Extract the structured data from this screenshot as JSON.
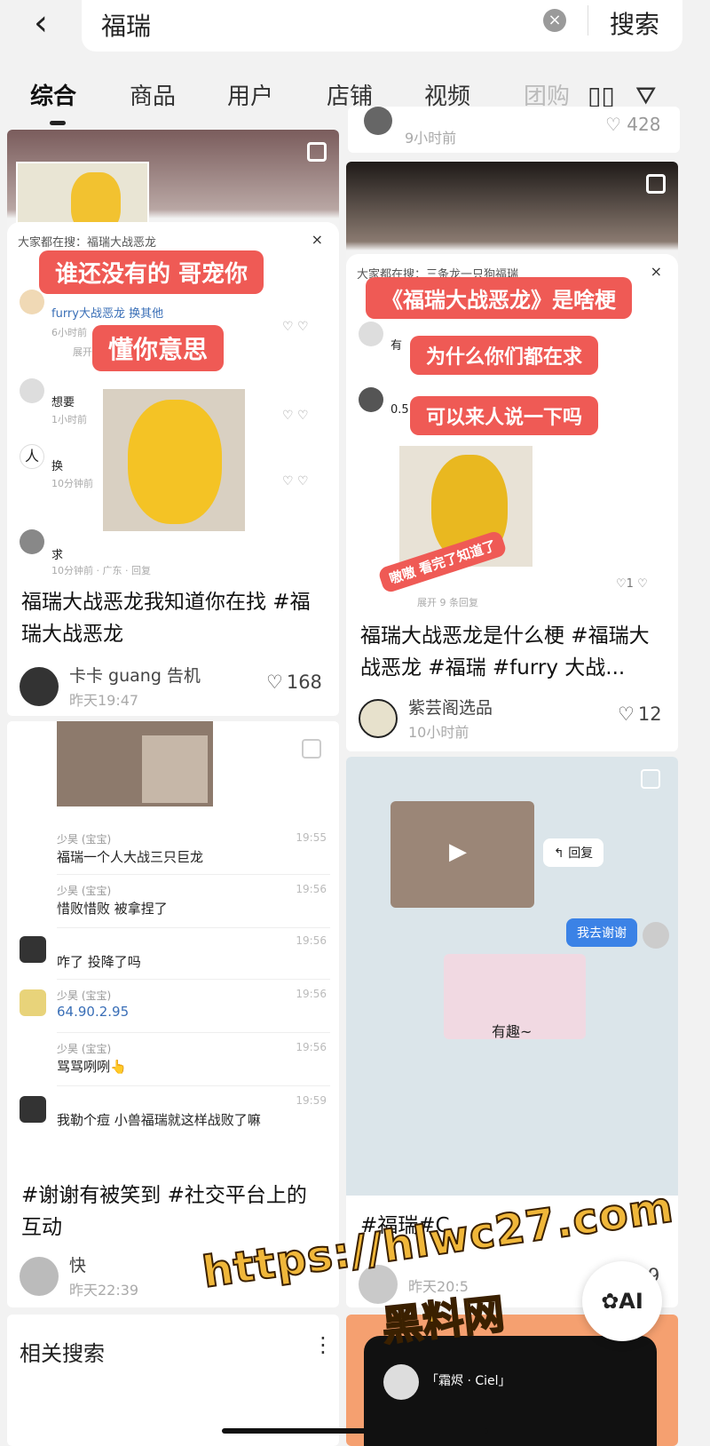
{
  "search": {
    "query": "福瑞",
    "button": "搜索"
  },
  "tabs": [
    "综合",
    "商品",
    "用户",
    "店铺",
    "视频",
    "团购"
  ],
  "top_partial_right": {
    "time": "9小时前",
    "likes": "428"
  },
  "cards": [
    {
      "bubbles": [
        "谁还没有的 哥宠你",
        "懂你意思"
      ],
      "overlay_top": "大家都在搜：福瑞大战恶龙",
      "comments": [
        {
          "text": "furry大战恶龙 换其他",
          "meta": "6小时前"
        },
        {
          "text": "想要",
          "meta": "1小时前"
        },
        {
          "text": "换",
          "meta": "10分钟前"
        },
        {
          "text": "求",
          "meta": "10分钟前 · 广东 · 回复"
        }
      ],
      "expand": "展开",
      "title": "福瑞大战恶龙我知道你在找 #福瑞大战恶龙",
      "author": "卡卡 guang 告机",
      "time": "昨天19:47",
      "likes": "168"
    },
    {
      "overlay_top": "大家都在搜：三条龙一只狗福瑞",
      "bubbles": [
        "《福瑞大战恶龙》是啥梗",
        "为什么你们都在求",
        "可以来人说一下吗"
      ],
      "comments": [
        {
          "text": "有"
        },
        {
          "text": "0.5"
        }
      ],
      "sticker": "嗷嗷 看完了知道了",
      "reply_count": "展开 9 条回复",
      "like_small": "1",
      "title": "福瑞大战恶龙是什么梗 #福瑞大战恶龙 #福瑞 #furry 大战...",
      "author": "紫芸阁选品",
      "time": "10小时前",
      "likes": "12"
    },
    {
      "chat": [
        {
          "name": "少昊 (宝宝)",
          "text": "福瑞一个人大战三只巨龙",
          "time": "19:55"
        },
        {
          "name": "少昊 (宝宝)",
          "text": "惜败惜败 被拿捏了",
          "time": "19:56"
        },
        {
          "name": "",
          "text": "咋了 投降了吗",
          "time": "19:56"
        },
        {
          "name": "少昊 (宝宝)",
          "text": "64.90.2.95",
          "time": "19:56"
        },
        {
          "name": "少昊 (宝宝)",
          "text": "骂骂咧咧👆",
          "time": "19:56"
        },
        {
          "name": "",
          "text": "我勒个痘 小兽福瑞就这样战败了嘛",
          "time": "19:59"
        }
      ],
      "title": "#谢谢有被笑到 #社交平台上的互动",
      "author": "快",
      "time": "昨天22:39"
    },
    {
      "reply": "回复",
      "sent": "我去谢谢",
      "caption": "有趣~",
      "title": "#福瑞#C",
      "time": "昨天20:5",
      "likes": "9"
    }
  ],
  "related": {
    "label": "相关搜索"
  },
  "bottom_right_name": "「霜烬 · Ciel」",
  "watermark": {
    "line1": "https://hlwc27.com",
    "line2": "黑料网"
  },
  "ai_label": "AI",
  "colors": {
    "accent": "#ef5a55",
    "bg": "#f2f2f2"
  }
}
